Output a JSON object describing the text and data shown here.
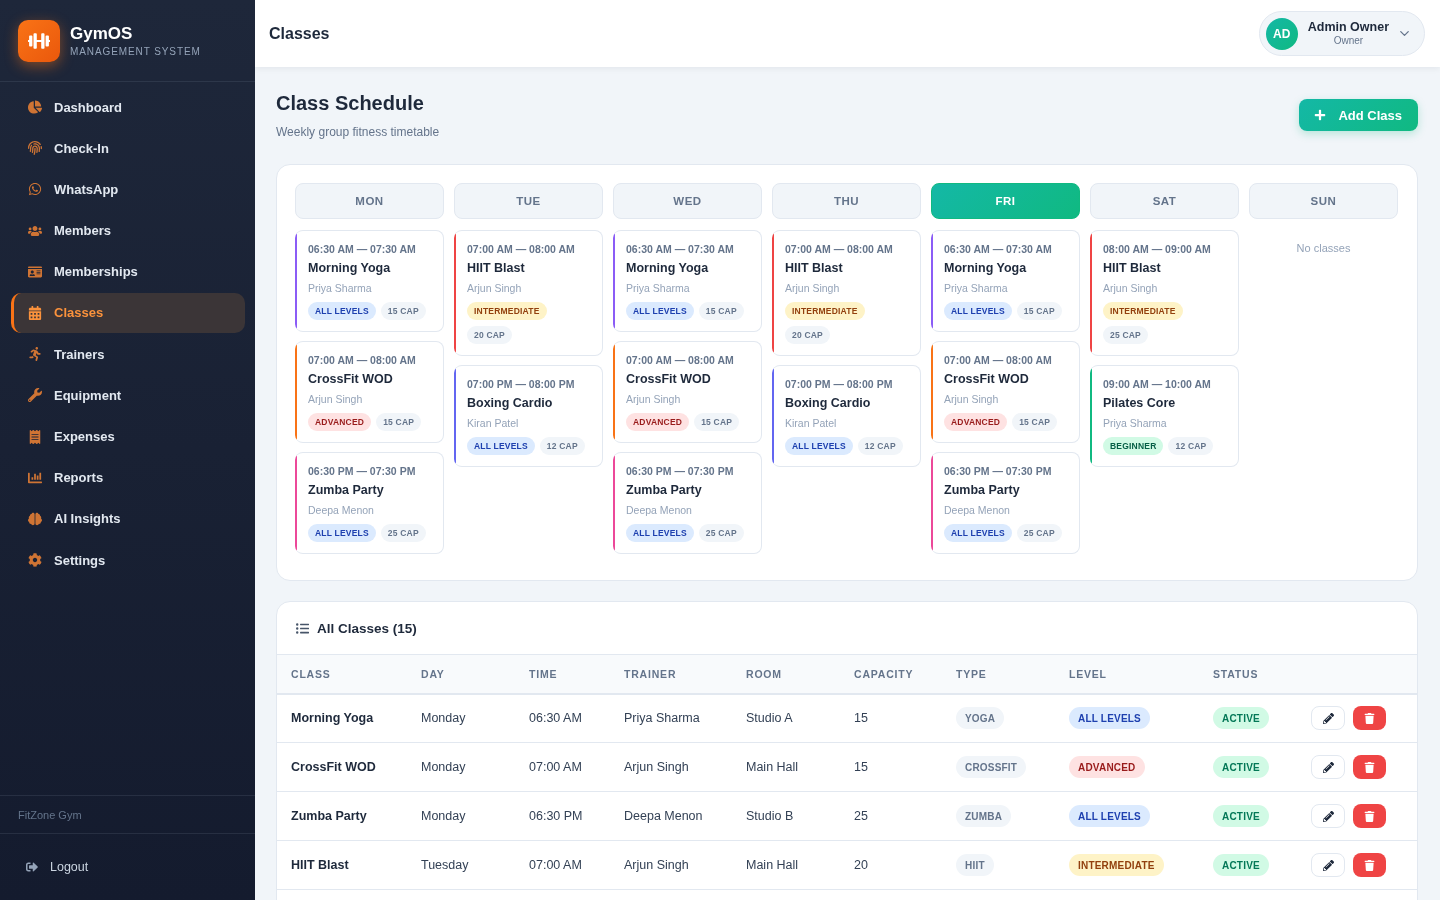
{
  "sidebar": {
    "brand": {
      "name": "GymOS",
      "tagline": "MANAGEMENT SYSTEM"
    },
    "items": [
      {
        "label": "Dashboard",
        "selected": false
      },
      {
        "label": "Check-In",
        "selected": false
      },
      {
        "label": "WhatsApp",
        "selected": false
      },
      {
        "label": "Members",
        "selected": false
      },
      {
        "label": "Memberships",
        "selected": false
      },
      {
        "label": "Classes",
        "selected": true
      },
      {
        "label": "Trainers",
        "selected": false
      },
      {
        "label": "Equipment",
        "selected": false
      },
      {
        "label": "Expenses",
        "selected": false
      },
      {
        "label": "Reports",
        "selected": false
      },
      {
        "label": "AI Insights",
        "selected": false
      },
      {
        "label": "Settings",
        "selected": false
      }
    ],
    "gym_name": "FitZone Gym",
    "logout": "Logout"
  },
  "header": {
    "title": "Classes",
    "user": {
      "initials": "AD",
      "name": "Admin Owner",
      "role": "Owner"
    }
  },
  "page": {
    "title": "Class Schedule",
    "subtitle": "Weekly group fitness timetable",
    "add_button": "Add Class"
  },
  "schedule": {
    "days": [
      {
        "label": "MON",
        "selected": false,
        "classes": [
          {
            "time": "06:30 AM — 07:30 AM",
            "name": "Morning Yoga",
            "trainer": "Priya Sharma",
            "color": "#8b5cf6",
            "difficulty": {
              "text": "ALL LEVELS",
              "kind": "all"
            },
            "capacity": "15 CAP"
          },
          {
            "time": "07:00 AM — 08:00 AM",
            "name": "CrossFit WOD",
            "trainer": "Arjun Singh",
            "color": "#f97316",
            "difficulty": {
              "text": "ADVANCED",
              "kind": "advanced"
            },
            "capacity": "15 CAP"
          },
          {
            "time": "06:30 PM — 07:30 PM",
            "name": "Zumba Party",
            "trainer": "Deepa Menon",
            "color": "#ec4899",
            "difficulty": {
              "text": "ALL LEVELS",
              "kind": "all"
            },
            "capacity": "25 CAP"
          }
        ]
      },
      {
        "label": "TUE",
        "selected": false,
        "classes": [
          {
            "time": "07:00 AM — 08:00 AM",
            "name": "HIIT Blast",
            "trainer": "Arjun Singh",
            "color": "#ef4444",
            "difficulty": {
              "text": "INTERMEDIATE",
              "kind": "intermediate"
            },
            "capacity": "20 CAP"
          },
          {
            "time": "07:00 PM — 08:00 PM",
            "name": "Boxing Cardio",
            "trainer": "Kiran Patel",
            "color": "#6366f1",
            "difficulty": {
              "text": "ALL LEVELS",
              "kind": "all"
            },
            "capacity": "12 CAP"
          }
        ]
      },
      {
        "label": "WED",
        "selected": false,
        "classes": [
          {
            "time": "06:30 AM — 07:30 AM",
            "name": "Morning Yoga",
            "trainer": "Priya Sharma",
            "color": "#8b5cf6",
            "difficulty": {
              "text": "ALL LEVELS",
              "kind": "all"
            },
            "capacity": "15 CAP"
          },
          {
            "time": "07:00 AM — 08:00 AM",
            "name": "CrossFit WOD",
            "trainer": "Arjun Singh",
            "color": "#f97316",
            "difficulty": {
              "text": "ADVANCED",
              "kind": "advanced"
            },
            "capacity": "15 CAP"
          },
          {
            "time": "06:30 PM — 07:30 PM",
            "name": "Zumba Party",
            "trainer": "Deepa Menon",
            "color": "#ec4899",
            "difficulty": {
              "text": "ALL LEVELS",
              "kind": "all"
            },
            "capacity": "25 CAP"
          }
        ]
      },
      {
        "label": "THU",
        "selected": false,
        "classes": [
          {
            "time": "07:00 AM — 08:00 AM",
            "name": "HIIT Blast",
            "trainer": "Arjun Singh",
            "color": "#ef4444",
            "difficulty": {
              "text": "INTERMEDIATE",
              "kind": "intermediate"
            },
            "capacity": "20 CAP"
          },
          {
            "time": "07:00 PM — 08:00 PM",
            "name": "Boxing Cardio",
            "trainer": "Kiran Patel",
            "color": "#6366f1",
            "difficulty": {
              "text": "ALL LEVELS",
              "kind": "all"
            },
            "capacity": "12 CAP"
          }
        ]
      },
      {
        "label": "FRI",
        "selected": true,
        "classes": [
          {
            "time": "06:30 AM — 07:30 AM",
            "name": "Morning Yoga",
            "trainer": "Priya Sharma",
            "color": "#8b5cf6",
            "difficulty": {
              "text": "ALL LEVELS",
              "kind": "all"
            },
            "capacity": "15 CAP"
          },
          {
            "time": "07:00 AM — 08:00 AM",
            "name": "CrossFit WOD",
            "trainer": "Arjun Singh",
            "color": "#f97316",
            "difficulty": {
              "text": "ADVANCED",
              "kind": "advanced"
            },
            "capacity": "15 CAP"
          },
          {
            "time": "06:30 PM — 07:30 PM",
            "name": "Zumba Party",
            "trainer": "Deepa Menon",
            "color": "#ec4899",
            "difficulty": {
              "text": "ALL LEVELS",
              "kind": "all"
            },
            "capacity": "25 CAP"
          }
        ]
      },
      {
        "label": "SAT",
        "selected": false,
        "classes": [
          {
            "time": "08:00 AM — 09:00 AM",
            "name": "HIIT Blast",
            "trainer": "Arjun Singh",
            "color": "#ef4444",
            "difficulty": {
              "text": "INTERMEDIATE",
              "kind": "intermediate"
            },
            "capacity": "25 CAP"
          },
          {
            "time": "09:00 AM — 10:00 AM",
            "name": "Pilates Core",
            "trainer": "Priya Sharma",
            "color": "#10b981",
            "difficulty": {
              "text": "BEGINNER",
              "kind": "beginner"
            },
            "capacity": "12 CAP"
          }
        ]
      },
      {
        "label": "SUN",
        "selected": false,
        "empty_text": "No classes"
      }
    ]
  },
  "table": {
    "title": "All Classes (15)",
    "columns": [
      "CLASS",
      "DAY",
      "TIME",
      "TRAINER",
      "ROOM",
      "CAPACITY",
      "TYPE",
      "LEVEL",
      "STATUS"
    ],
    "rows": [
      {
        "class": "Morning Yoga",
        "day": "Monday",
        "time": "06:30 AM",
        "trainer": "Priya Sharma",
        "room": "Studio A",
        "capacity": "15",
        "type": "YOGA",
        "difficulty": {
          "text": "ALL LEVELS",
          "kind": "all"
        },
        "status": {
          "text": "ACTIVE",
          "kind": "active"
        }
      },
      {
        "class": "CrossFit WOD",
        "day": "Monday",
        "time": "07:00 AM",
        "trainer": "Arjun Singh",
        "room": "Main Hall",
        "capacity": "15",
        "type": "CROSSFIT",
        "difficulty": {
          "text": "ADVANCED",
          "kind": "advanced"
        },
        "status": {
          "text": "ACTIVE",
          "kind": "active"
        }
      },
      {
        "class": "Zumba Party",
        "day": "Monday",
        "time": "06:30 PM",
        "trainer": "Deepa Menon",
        "room": "Studio B",
        "capacity": "25",
        "type": "ZUMBA",
        "difficulty": {
          "text": "ALL LEVELS",
          "kind": "all"
        },
        "status": {
          "text": "ACTIVE",
          "kind": "active"
        }
      },
      {
        "class": "HIIT Blast",
        "day": "Tuesday",
        "time": "07:00 AM",
        "trainer": "Arjun Singh",
        "room": "Main Hall",
        "capacity": "20",
        "type": "HIIT",
        "difficulty": {
          "text": "INTERMEDIATE",
          "kind": "intermediate"
        },
        "status": {
          "text": "ACTIVE",
          "kind": "active"
        }
      }
    ]
  }
}
